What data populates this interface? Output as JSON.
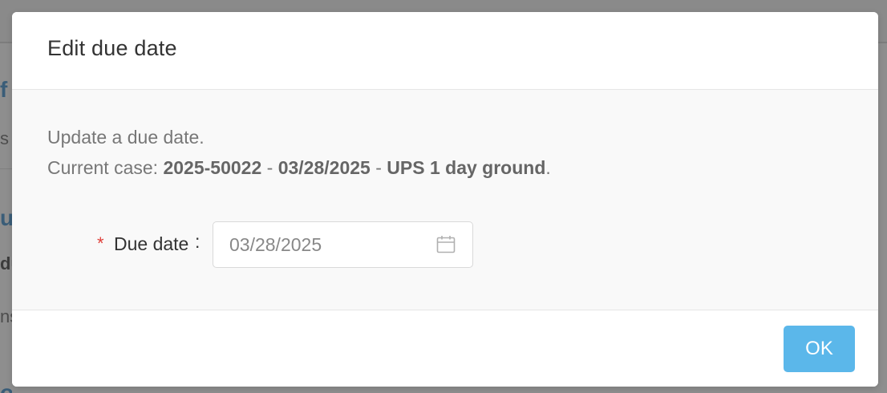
{
  "background": {
    "fragments": [
      "f",
      "s s",
      "u",
      "du",
      "ns",
      "o"
    ]
  },
  "dialog": {
    "title": "Edit due date",
    "description": "Update a due date.",
    "current_case_prefix": "Current case: ",
    "case_id": "2025-50022",
    "separator": " - ",
    "case_date": "03/28/2025",
    "case_service": "UPS 1 day ground",
    "trailing_period": ".",
    "field": {
      "required_mark": "*",
      "label": "Due date",
      "colon": ":",
      "value": "03/28/2025",
      "icon": "calendar-icon"
    },
    "ok_label": "OK"
  },
  "colors": {
    "accent": "#5bb7ea",
    "required": "#e0403a",
    "overlay": "#8e8e8e"
  }
}
